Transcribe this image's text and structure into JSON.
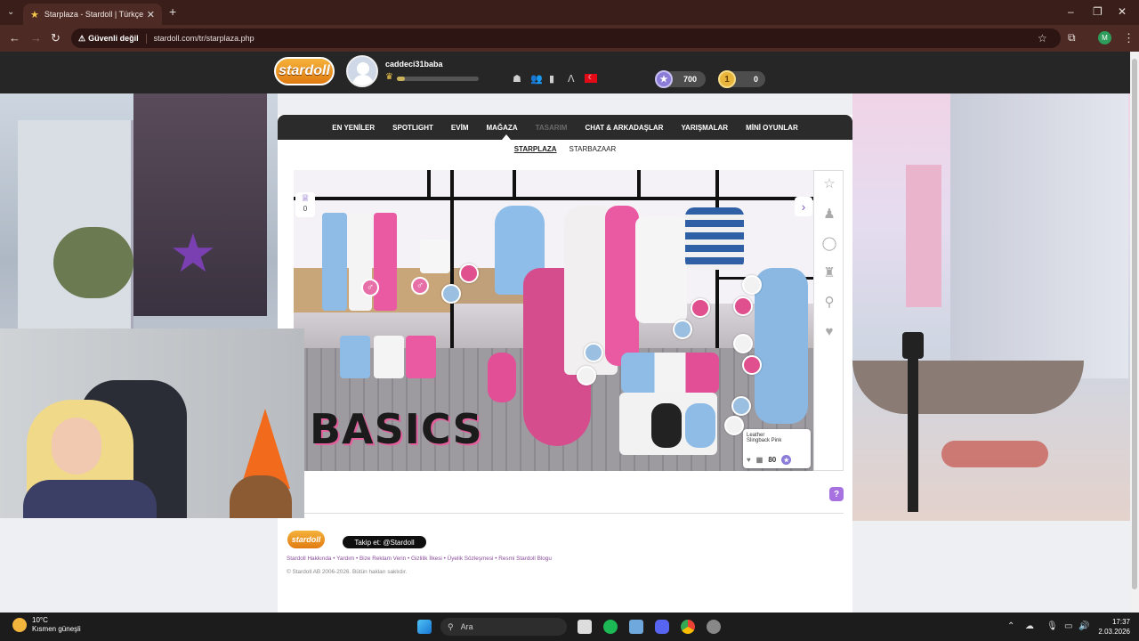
{
  "browser": {
    "tab_title": "Starplaza - Stardoll | Türkçe",
    "security_label": "Güvenli değil",
    "url": "stardoll.com/tr/starplaza.php",
    "profile_initial": "M"
  },
  "header": {
    "logo": "stardoll",
    "username": "caddeci31baba",
    "level_progress": 0.1,
    "stardollars": "700",
    "coins": "0"
  },
  "main_nav": [
    {
      "label": "EN YENİLER"
    },
    {
      "label": "SPOTLIGHT"
    },
    {
      "label": "EVİM"
    },
    {
      "label": "MAĞAZA"
    },
    {
      "label": "TASARIM"
    },
    {
      "label": "CHAT & ARKADAŞLAR"
    },
    {
      "label": "YARIŞMALAR"
    },
    {
      "label": "MİNİ OYUNLAR"
    }
  ],
  "sub_nav": [
    {
      "label": "STARPLAZA"
    },
    {
      "label": "STARBAZAAR"
    }
  ],
  "store": {
    "banner_text": "BASICS",
    "basket_count": "0",
    "tooltip_name_line1": "Leather",
    "tooltip_name_line2": "Slingback Pink",
    "tooltip_price": "80"
  },
  "footer": {
    "logo": "stardoll",
    "follow": "Takip et: @Stardoll",
    "links": "Stardoll Hakkında • Yardım • Bize Reklam Verin • Gizlilik İlkesi • Üyelik Sözleşmesi • Resmi Stardoll Blogu",
    "copyright": "© Stardoll AB 2006-2026. Bütün hakları saklıdır."
  },
  "taskbar": {
    "temperature": "10°C",
    "weather": "Kısmen güneşli",
    "search": "Ara",
    "time": "17:37",
    "date": "2.03.2026"
  },
  "colors": {
    "accent": "#7d5bc0",
    "nav_bg": "#2b2b2b",
    "chrome": "#4e2a24"
  }
}
